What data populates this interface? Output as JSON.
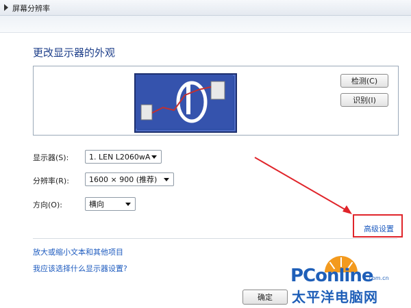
{
  "breadcrumb": "屏幕分辨率",
  "heading": "更改显示器的外观",
  "preview": {
    "detect_label": "检测(C)",
    "identify_label": "识别(I)"
  },
  "form": {
    "display_label": "显示器(S):",
    "display_value": "1. LEN L2060wA",
    "resolution_label": "分辨率(R):",
    "resolution_value": "1600 × 900 (推荐)",
    "orientation_label": "方向(O):",
    "orientation_value": "横向"
  },
  "links": {
    "advanced": "高级设置",
    "text_size": "放大或缩小文本和其他项目",
    "which_settings": "我应该选择什么显示器设置?"
  },
  "footer": {
    "ok_label": "确定"
  },
  "watermark": {
    "brand": "PConline",
    "domain": ".com.cn",
    "chinese": "太平洋电脑网"
  },
  "colors": {
    "accent_link": "#1d5bbf",
    "heading": "#1e3f8a",
    "highlight": "#e0242a",
    "monitor": "#2f4fa8"
  },
  "icons": [
    "triangle-right-icon",
    "chevron-down-icon",
    "monitor-icon",
    "arrow-icon"
  ]
}
